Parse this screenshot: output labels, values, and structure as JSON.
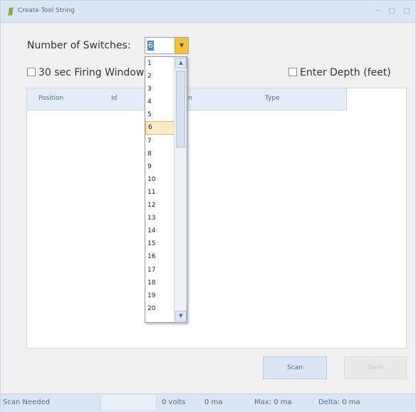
{
  "window": {
    "title": "Create Tool String",
    "controls": [
      "minimize",
      "maximize",
      "close"
    ]
  },
  "form": {
    "switches_label": "Number of Switches:",
    "switches_value": "6",
    "firing_window_label": "30 sec Firing Window",
    "firing_window_checked": false,
    "enter_depth_label": "Enter Depth (feet)",
    "enter_depth_checked": false
  },
  "table": {
    "columns": [
      "Position",
      "Id",
      "n",
      "Type"
    ],
    "rows": []
  },
  "dropdown": {
    "options": [
      "1",
      "2",
      "3",
      "4",
      "5",
      "6",
      "7",
      "8",
      "9",
      "10",
      "11",
      "12",
      "13",
      "14",
      "15",
      "16",
      "17",
      "18",
      "19",
      "20"
    ],
    "selected": "6",
    "scroll_up_icon": "chevron-up-icon",
    "scroll_down_icon": "chevron-down-icon"
  },
  "buttons": {
    "scan_label": "Scan",
    "save_label": "Save",
    "save_enabled": false
  },
  "status": {
    "message": "Scan Needed",
    "volts": "0 volts",
    "current": "0 ma",
    "max": "Max: 0 ma",
    "delta": "Delta: 0 ma"
  },
  "colors": {
    "accent": "#f6c13a",
    "titlebar": "#dbe6f4",
    "selection": "#fdebc6"
  }
}
